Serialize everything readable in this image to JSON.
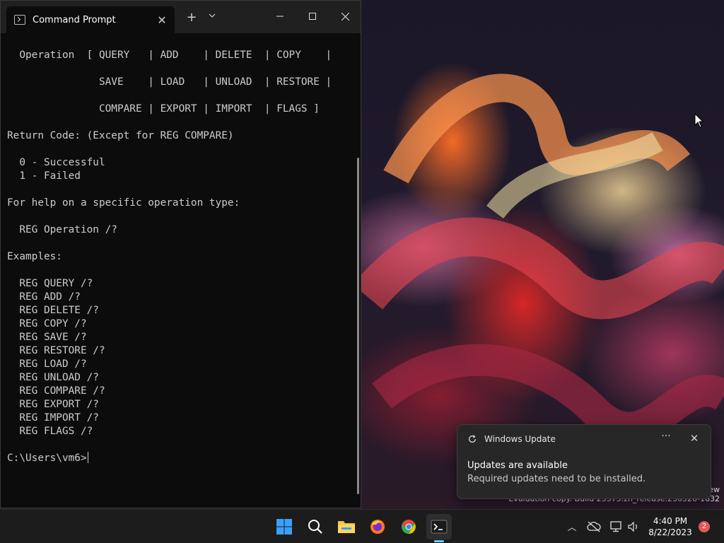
{
  "window": {
    "tab_title": "Command Prompt",
    "tab_close": "✕",
    "new_tab": "+",
    "dropdown": "⌄"
  },
  "console": {
    "lines": [
      "  Operation  [ QUERY   | ADD    | DELETE  | COPY    |",
      "",
      "               SAVE    | LOAD   | UNLOAD  | RESTORE |",
      "",
      "               COMPARE | EXPORT | IMPORT  | FLAGS ]",
      "",
      "Return Code: (Except for REG COMPARE)",
      "",
      "  0 - Successful",
      "  1 - Failed",
      "",
      "For help on a specific operation type:",
      "",
      "  REG Operation /?",
      "",
      "Examples:",
      "",
      "  REG QUERY /?",
      "  REG ADD /?",
      "  REG DELETE /?",
      "  REG COPY /?",
      "  REG SAVE /?",
      "  REG RESTORE /?",
      "  REG LOAD /?",
      "  REG UNLOAD /?",
      "  REG COMPARE /?",
      "  REG EXPORT /?",
      "  REG IMPORT /?",
      "  REG FLAGS /?",
      ""
    ],
    "prompt": "C:\\Users\\vm6>"
  },
  "watermark": {
    "line1": "ew",
    "line2": "Evaluation copy. Build 25375.zn_release.230520-1632"
  },
  "notification": {
    "app_name": "Windows Update",
    "more": "···",
    "close": "✕",
    "title": "Updates are available",
    "body": "Required updates need to be installed."
  },
  "tray": {
    "chevron": "︿",
    "time": "4:40 PM",
    "date": "8/22/2023",
    "badge_count": "2"
  },
  "colors": {
    "console_fg": "#cccccc",
    "console_bg": "#0c0c0c",
    "accent": "#60cdff",
    "badge": "#e0595b"
  }
}
